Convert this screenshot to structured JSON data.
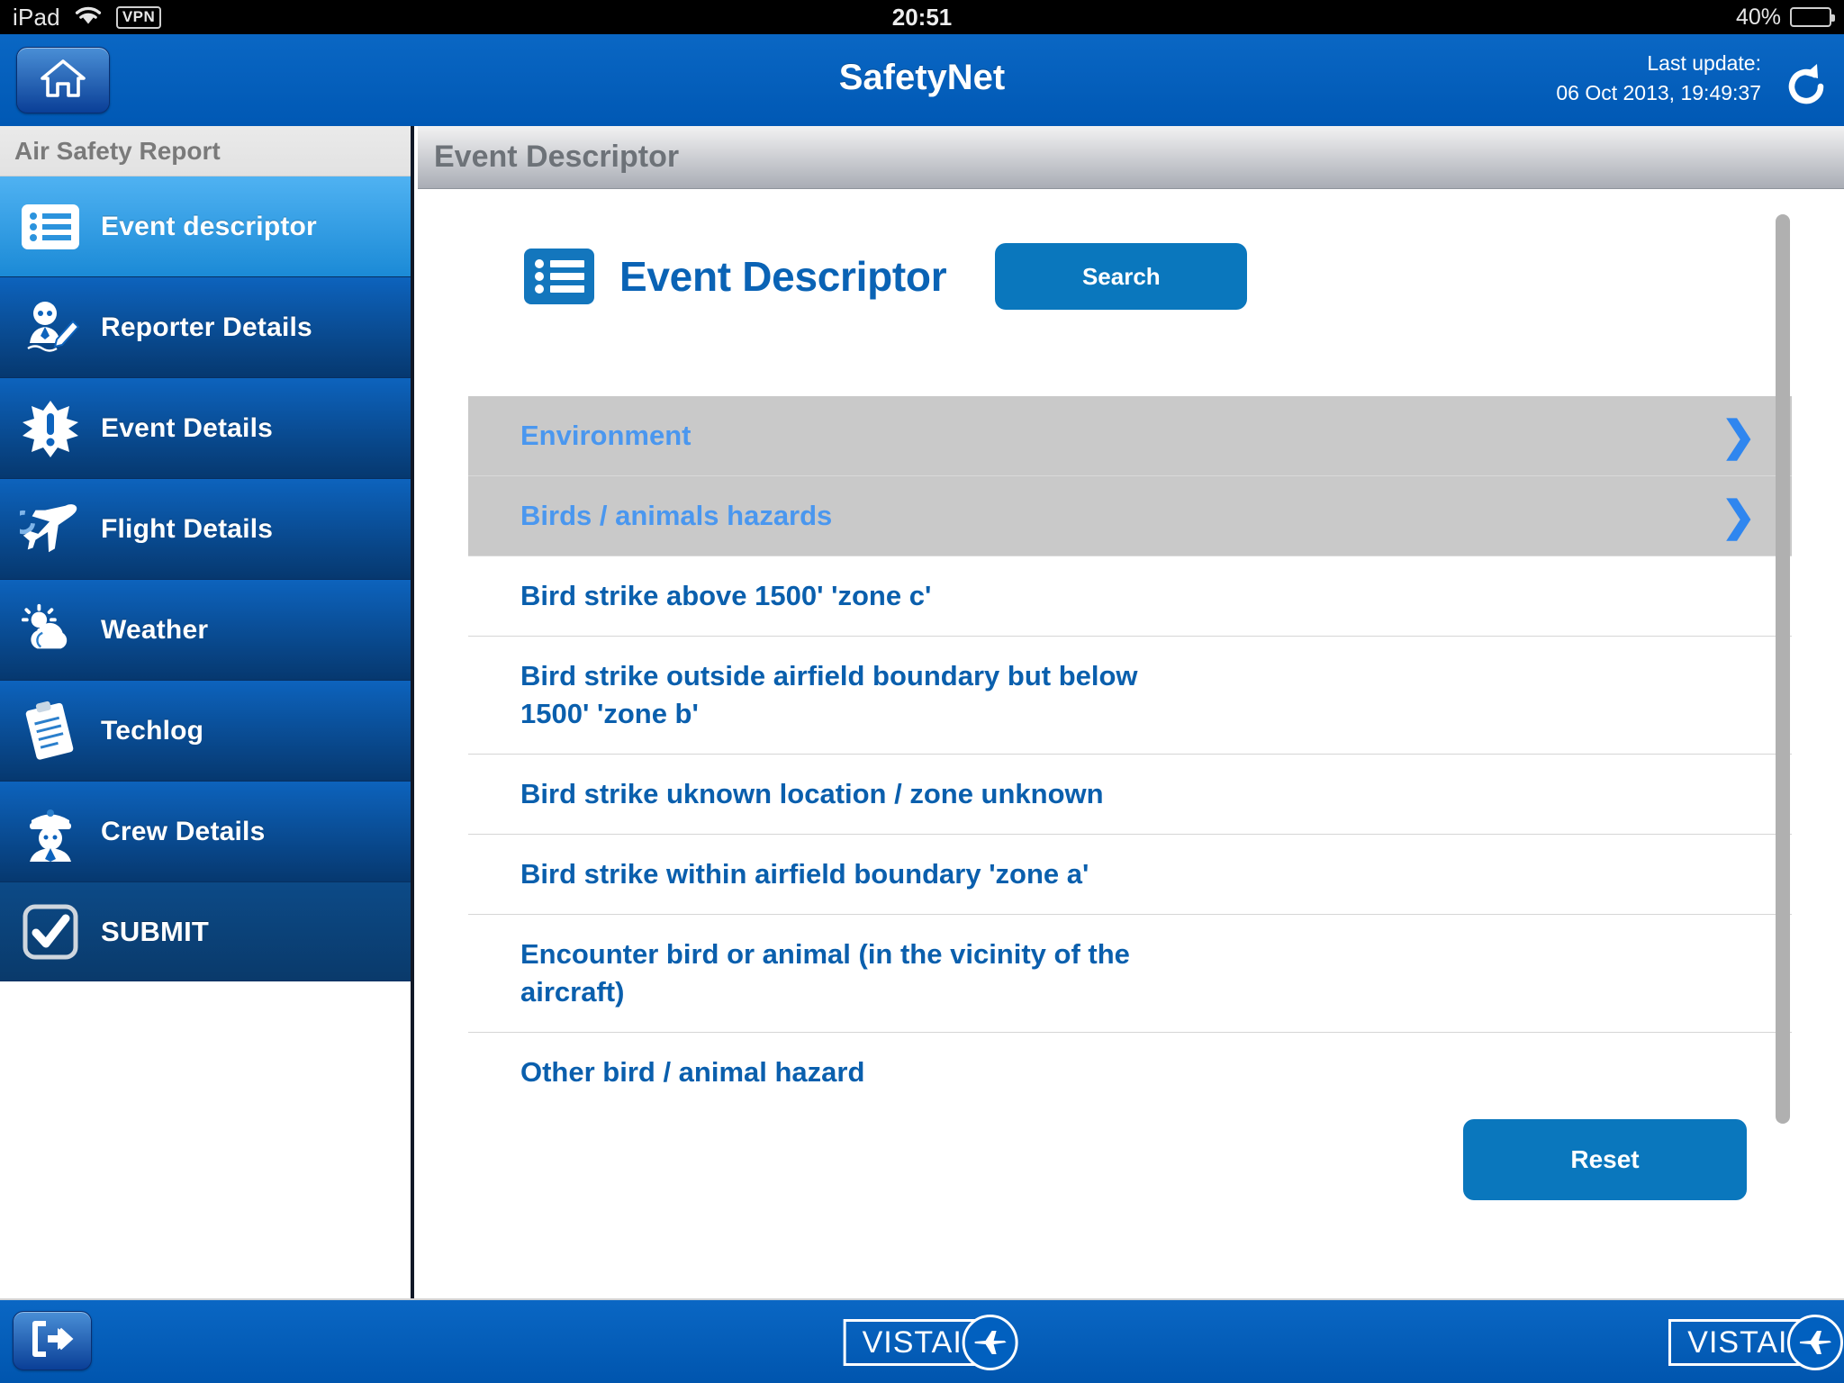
{
  "statusbar": {
    "device": "iPad",
    "wifi_icon": "wifi-icon",
    "vpn_label": "VPN",
    "time": "20:51",
    "battery_percent": "40%",
    "battery_level": 40
  },
  "header": {
    "home_icon": "home-icon",
    "app_title": "SafetyNet",
    "last_update_label": "Last update:",
    "last_update_value": "06 Oct 2013, 19:49:37",
    "refresh_icon": "refresh-icon"
  },
  "sidebar": {
    "section_title": "Air Safety Report",
    "items": [
      {
        "label": "Event descriptor",
        "icon": "list-icon",
        "active": true
      },
      {
        "label": "Reporter Details",
        "icon": "reporter-icon",
        "active": false
      },
      {
        "label": "Event Details",
        "icon": "burst-icon",
        "active": false
      },
      {
        "label": "Flight Details",
        "icon": "airplane-icon",
        "active": false
      },
      {
        "label": "Weather",
        "icon": "sun-cloud-icon",
        "active": false
      },
      {
        "label": "Techlog",
        "icon": "clipboard-icon",
        "active": false
      },
      {
        "label": "Crew Details",
        "icon": "pilot-icon",
        "active": false
      },
      {
        "label": "SUBMIT",
        "icon": "checkbox-icon",
        "active": false
      }
    ]
  },
  "content": {
    "breadcrumb_title": "Event Descriptor",
    "panel_icon": "list-icon",
    "panel_title": "Event Descriptor",
    "search_label": "Search",
    "reset_label": "Reset",
    "chevron_icon": "chevron-right-icon",
    "breadcrumb_rows": [
      {
        "label": "Environment"
      },
      {
        "label": "Birds / animals hazards"
      }
    ],
    "option_rows": [
      {
        "label": "Bird strike above 1500' 'zone c'"
      },
      {
        "label": "Bird strike outside airfield boundary but below 1500' 'zone b'"
      },
      {
        "label": "Bird strike uknown location / zone unknown"
      },
      {
        "label": "Bird strike within airfield boundary 'zone a'"
      },
      {
        "label": "Encounter bird or animal (in the vicinity of the aircraft)"
      },
      {
        "label": "Other bird / animal hazard"
      }
    ]
  },
  "footer": {
    "logout_icon": "logout-icon",
    "brand_center": "VISTAIR",
    "brand_right": "VISTAIR"
  },
  "colors": {
    "header_blue": "#0160bf",
    "sidebar_active_blue": "#4fb2f2",
    "sidebar_inactive_blue": "#0d63bd",
    "link_blue": "#0a5fad",
    "crumb_link_blue": "#4a97ef",
    "button_blue": "#0a77bd",
    "crumb_row_gray": "#c9c9c9"
  }
}
